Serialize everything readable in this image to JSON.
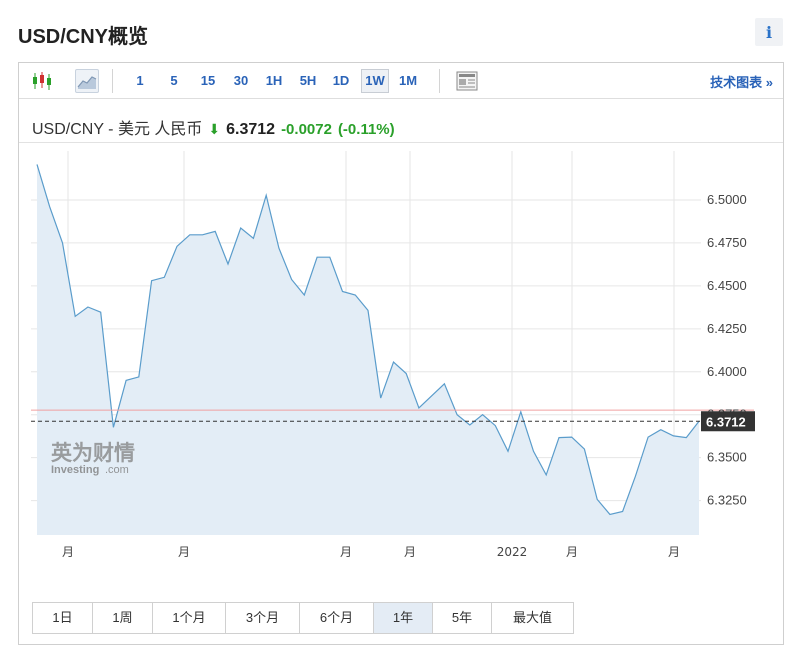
{
  "header": {
    "title": "USD/CNY概览",
    "info_label": "i"
  },
  "toolbar": {
    "intervals": [
      "1",
      "5",
      "15",
      "30",
      "1H",
      "5H",
      "1D",
      "1W",
      "1M"
    ],
    "active_interval": "1W",
    "tech_link": "技术图表 »"
  },
  "quote": {
    "name": "USD/CNY - 美元 人民币",
    "price": "6.3712",
    "change": "-0.0072",
    "change_pct": "(-0.11%)",
    "change_color": "#2aa02a"
  },
  "watermark": {
    "cn": "英为财情",
    "en": "Investing",
    "en_suffix": ".com"
  },
  "range_buttons": [
    "1日",
    "1周",
    "1个月",
    "3个月",
    "6个月",
    "1年",
    "5年",
    "最大值"
  ],
  "active_range": "1年",
  "chart_data": {
    "type": "area",
    "yticks": [
      "6.3250",
      "6.3500",
      "6.3750",
      "6.4000",
      "6.4250",
      "6.4500",
      "6.4750",
      "6.5000"
    ],
    "ylim": [
      6.305,
      6.525
    ],
    "x_labels": [
      "月",
      "月",
      "月",
      "月",
      "2022",
      "月",
      "月"
    ],
    "last_price_label": "6.3712",
    "last_price": 6.3712,
    "reference_level": 6.3777,
    "series": [
      {
        "values": [
          6.5207,
          6.496,
          6.475,
          6.4323,
          6.4377,
          6.4347,
          6.3677,
          6.395,
          6.397,
          6.453,
          6.455,
          6.473,
          6.4797,
          6.4797,
          6.4817,
          6.4627,
          6.4837,
          6.4777,
          6.5027,
          6.472,
          6.4537,
          6.4447,
          6.4667,
          6.4667,
          6.4467,
          6.4447,
          6.4357,
          6.3847,
          6.4057,
          6.399,
          6.379,
          6.386,
          6.393,
          6.375,
          6.369,
          6.375,
          6.3687,
          6.3537,
          6.3767,
          6.3537,
          6.34,
          6.3617,
          6.362,
          6.355,
          6.3257,
          6.317,
          6.3187,
          6.339,
          6.362,
          6.3663,
          6.3627,
          6.3617,
          6.3712
        ]
      }
    ],
    "colors": {
      "line": "#5a9ccb",
      "fill": "#e3edf6",
      "reference": "#f0a0a0",
      "last_box": "#333333"
    }
  }
}
